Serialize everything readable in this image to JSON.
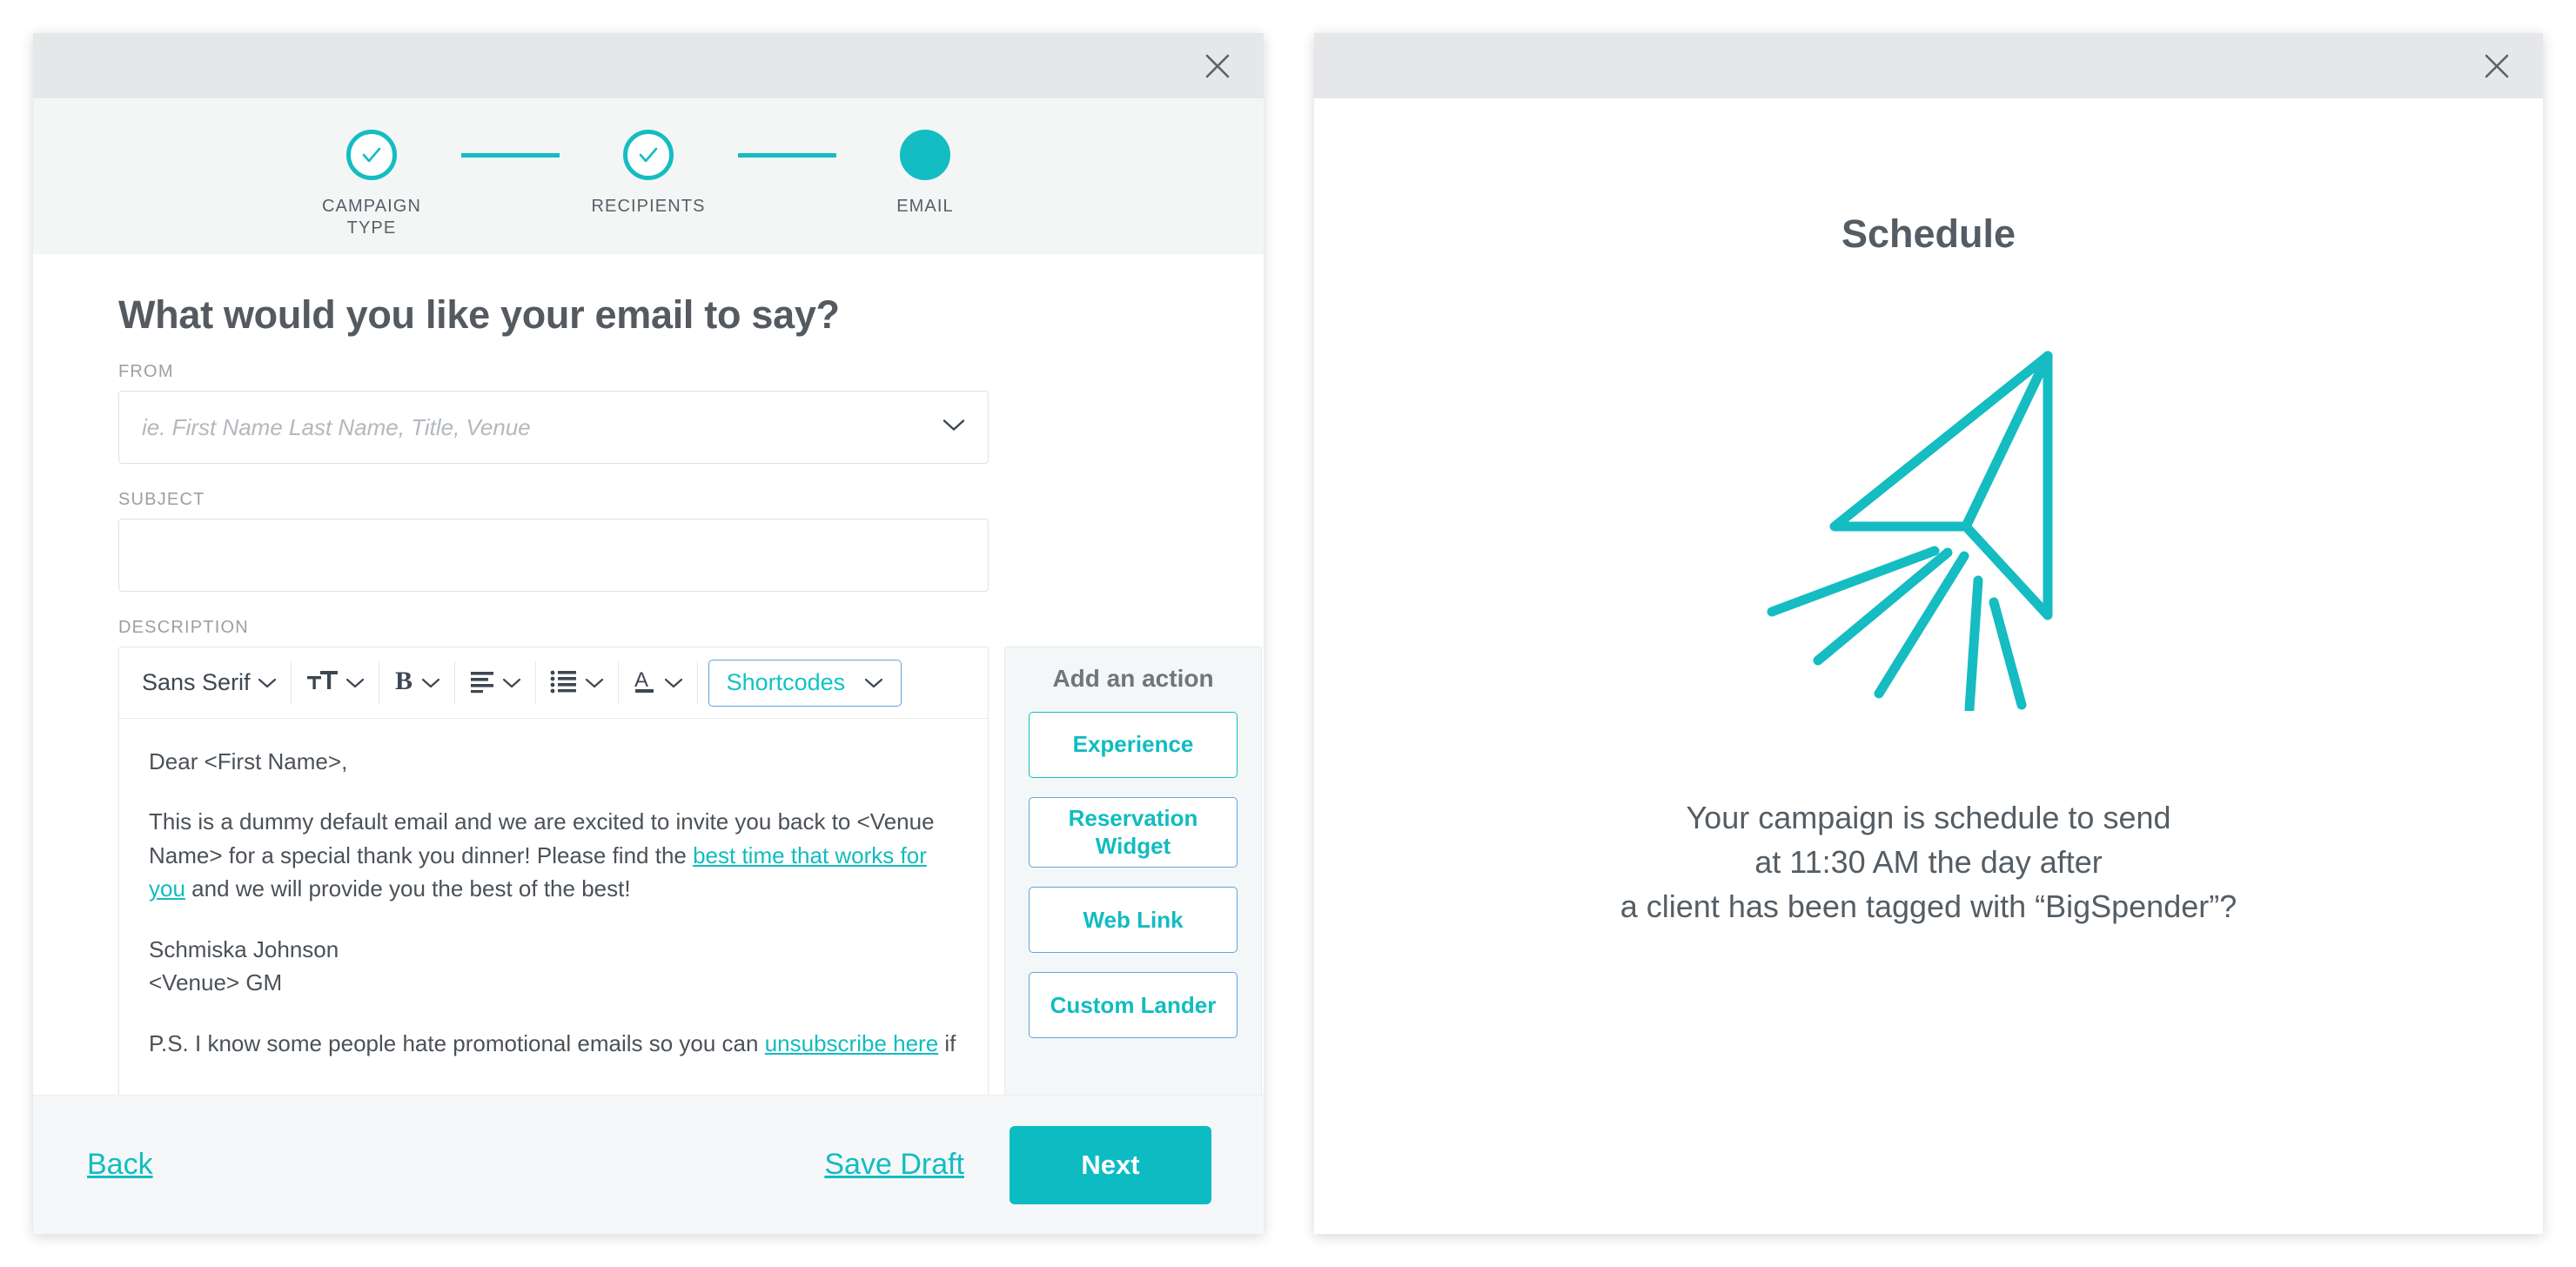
{
  "left_modal": {
    "close_icon": "close-icon",
    "stepper": [
      {
        "label": "CAMPAIGN\nTYPE",
        "state": "complete",
        "icon": "check-icon"
      },
      {
        "label": "RECIPIENTS",
        "state": "complete",
        "icon": "check-icon"
      },
      {
        "label": "EMAIL",
        "state": "current",
        "icon": "filled-dot"
      }
    ],
    "page_title": "What would you like your email to say?",
    "fields": {
      "from_label": "FROM",
      "from_placeholder": "ie. First Name Last Name, Title, Venue",
      "from_value": "",
      "subject_label": "SUBJECT",
      "subject_value": "",
      "description_label": "DESCRIPTION"
    },
    "toolbar": {
      "font_family": "Sans Serif",
      "font_size_icon": "font-size-icon",
      "bold_icon": "bold-icon",
      "align_icon": "align-left-icon",
      "list_icon": "bulleted-list-icon",
      "text_color_icon": "text-color-icon",
      "shortcodes_label": "Shortcodes",
      "chevron_icon": "chevron-down-icon"
    },
    "email_body": {
      "greeting": "Dear <First Name>,",
      "para1_a": "This is a dummy default email and we are excited to invite you back to <Venue Name> for a special thank you dinner! Please find the ",
      "para1_link": "best time that works for you",
      "para1_b": " and we will provide you the best of the best!",
      "signature_name": "Schmiska Johnson",
      "signature_title": "<Venue> GM",
      "ps_a": "P.S. I know some people hate promotional emails so you can ",
      "ps_link": "unsubscribe here",
      "ps_b": " if you really want"
    },
    "actions": {
      "title": "Add an action",
      "items": [
        {
          "label": "Experience"
        },
        {
          "label": "Reservation Widget"
        },
        {
          "label": "Web Link"
        },
        {
          "label": "Custom Lander"
        }
      ]
    },
    "footer": {
      "back_label": "Back",
      "save_draft_label": "Save Draft",
      "next_label": "Next"
    }
  },
  "right_modal": {
    "close_icon": "close-icon",
    "title": "Schedule",
    "illustration": "paper-plane-icon",
    "message_line1": "Your campaign is schedule to send",
    "message_line2": "at 11:30 AM the day after",
    "message_line3": "a client has been tagged with “BigSpender”?"
  },
  "colors": {
    "accent_teal": "#13bdc2",
    "accent_blue_border": "#62a4dd",
    "text_dark": "#545a60",
    "text_muted": "#9aa0a6",
    "header_gray": "#e6e7e9",
    "panel_gray": "#f4f6f6"
  }
}
